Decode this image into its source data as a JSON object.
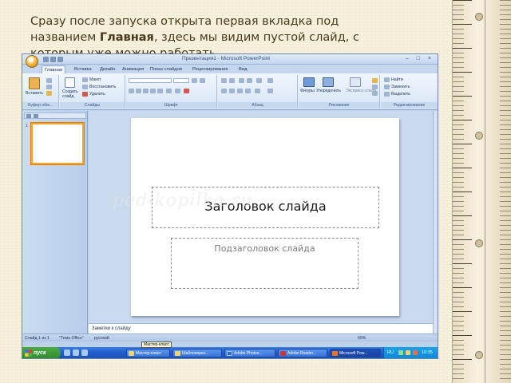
{
  "caption": {
    "line1": "Сразу после запуска открыта первая вкладка под",
    "line2_pre": "названием ",
    "line2_bold": "Главная",
    "line2_post": ", здесь мы видим пустой слайд, с",
    "line3": "которым уже можно работать."
  },
  "window": {
    "title": "Презентация1 - Microsoft PowerPoint",
    "controls": "– □ ×"
  },
  "tabs": [
    "Главная",
    "Вставка",
    "Дизайн",
    "Анимация",
    "Показ слайдов",
    "Рецензирование",
    "Вид"
  ],
  "ribbon": {
    "clipboard": {
      "paste": "Вставить",
      "label": "Буфер обм..."
    },
    "slides": {
      "new_slide": "Создать слайд",
      "layout": "Макет",
      "reset": "Восстановить",
      "delete": "Удалить",
      "label": "Слайды"
    },
    "font": {
      "label": "Шрифт"
    },
    "paragraph": {
      "label": "Абзац"
    },
    "drawing": {
      "shapes": "Фигуры",
      "arrange": "Упорядочить",
      "styles": "Экспресс-стили",
      "label": "Рисование"
    },
    "editing": {
      "find": "Найти",
      "replace": "Заменить",
      "select": "Выделить",
      "label": "Редактирование"
    }
  },
  "slide": {
    "title_placeholder": "Заголовок слайда",
    "subtitle_placeholder": "Подзаголовок слайда",
    "watermark": "ped-kopilka.ru",
    "thumb_number": "1"
  },
  "notes": {
    "placeholder": "Заметки к слайду"
  },
  "statusbar": {
    "slide_info": "Слайд 1 из 1",
    "theme": "\"Тема Office\"",
    "language": "русский",
    "zoom": "69%"
  },
  "tooltip": "Мастер-класс",
  "taskbar": {
    "start": "пуск",
    "items": [
      "Мастер-класс",
      "Шаблонпрез...",
      "Adobe Photos...",
      "Adobe Reader...",
      "Microsoft Pow..."
    ],
    "lang": "RU",
    "clock": "10:35"
  },
  "colors": {
    "ribbon_bg": "#d7e5f6",
    "accent_orange": "#f1a62e",
    "taskbar_blue": "#225fd0",
    "start_green": "#2f8b2b"
  }
}
